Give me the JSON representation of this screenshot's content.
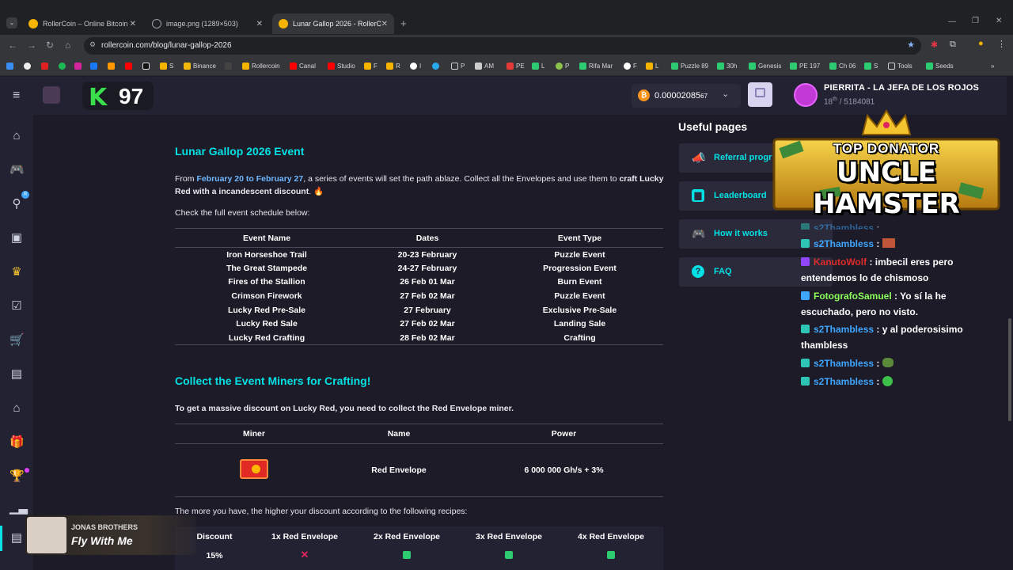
{
  "browser": {
    "tabs": [
      {
        "title": "RollerCoin – Online Bitcoin Min"
      },
      {
        "title": "image.png (1289×503)"
      },
      {
        "title": "Lunar Gallop 2026 - RollerCoin"
      }
    ],
    "url": "rollercoin.com/blog/lunar-gallop-2026",
    "bookmarks": [
      "S",
      "Binance",
      "Rollercoin",
      "Canal",
      "Studio",
      "F",
      "R",
      "I",
      "P",
      "AM",
      "PE",
      "L",
      "P",
      "Rifa Mar",
      "F",
      "L",
      "Puzzle 89",
      "30h",
      "Genesis",
      "PE 197",
      "Ch 06",
      "S",
      "Tools",
      "Seeds"
    ]
  },
  "header": {
    "k_score": "97",
    "balance": "0.00002085",
    "balance_suffix": "67",
    "username": "PIERRITA - LA JEFA DE LOS ROJOS",
    "rank_num": "18",
    "rank_suffix": "th",
    "rank_total": "/ 5184081"
  },
  "article": {
    "title": "Lunar Gallop 2026 Event",
    "intro_from": "From ",
    "intro_dates": "February 20 to February 27",
    "intro_mid": ", a series of events will set the path ablaze. Collect all the Envelopes and use them to ",
    "intro_bold": "craft Lucky Red with a incandescent discount",
    "intro_end": ". 🔥",
    "schedule_note": "Check the full event schedule below:",
    "table_headers": [
      "Event Name",
      "Dates",
      "Event Type"
    ],
    "events": [
      [
        "Iron Horseshoe Trail",
        "20-23 February",
        "Puzzle Event"
      ],
      [
        "The Great Stampede",
        "24-27 February",
        "Progression Event"
      ],
      [
        "Fires of the Stallion",
        "26 Feb 01 Mar",
        "Burn Event"
      ],
      [
        "Crimson Firework",
        "27 Feb 02 Mar",
        "Puzzle Event"
      ],
      [
        "Lucky Red Pre-Sale",
        "27 February",
        "Exclusive Pre-Sale"
      ],
      [
        "Lucky Red Sale",
        "27 Feb 02 Mar",
        "Landing Sale"
      ],
      [
        "Lucky Red Crafting",
        "28 Feb 02 Mar",
        "Crafting"
      ]
    ],
    "section2_title": "Collect the Event Miners for Crafting!",
    "section2_text": "To get a massive discount on Lucky Red, you need to collect the Red Envelope miner.",
    "miner_headers": [
      "Miner",
      "Name",
      "Power"
    ],
    "miner": {
      "name": "Red Envelope",
      "power": "6 000 000 Gh/s + 3%"
    },
    "recipes_note": "The more you have, the higher your discount according to the following recipes:",
    "recipe_headers": [
      "Discount",
      "1x Red Envelope",
      "2x Red Envelope",
      "3x Red Envelope",
      "4x Red Envelope"
    ],
    "recipe_first": "15%"
  },
  "useful": {
    "title": "Useful pages",
    "items": [
      "Referral progr",
      "Leaderboard",
      "How it works",
      "FAQ"
    ]
  },
  "donator": {
    "line1": "TOP DONATOR",
    "line2": "UNCLE HAMSTER"
  },
  "chat": [
    {
      "user": "s2Thambless",
      "text": ":"
    },
    {
      "user": "KanutoWolf",
      "text": ": imbecil eres pero entendemos lo de chismoso"
    },
    {
      "user": "FotografoSamuel",
      "text": ": Yo sí la he escuchado, pero no visto."
    },
    {
      "user": "s2Thambless",
      "text": ": y al poderosisimo thambless"
    },
    {
      "user": "s2Thambless",
      "text": ":"
    },
    {
      "user": "s2Thambless",
      "text": ":"
    }
  ],
  "music": {
    "artist": "JONAS BROTHERS",
    "title": "Fly With Me"
  },
  "colors": {
    "accent": "#03e1e4",
    "bg": "#1c1b27",
    "panel": "#232232"
  }
}
